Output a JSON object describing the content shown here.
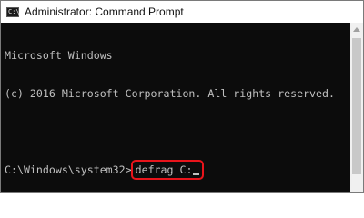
{
  "window": {
    "title": "Administrator: Command Prompt",
    "icon_label": "C:\\"
  },
  "console": {
    "lines": [
      "Microsoft Windows",
      "(c) 2016 Microsoft Corporation. All rights reserved.",
      ""
    ],
    "prompt": "C:\\Windows\\system32>",
    "command": "defrag C:"
  },
  "colors": {
    "background": "#0c0c0c",
    "text": "#c0c0c0",
    "highlight": "#e8141b"
  }
}
